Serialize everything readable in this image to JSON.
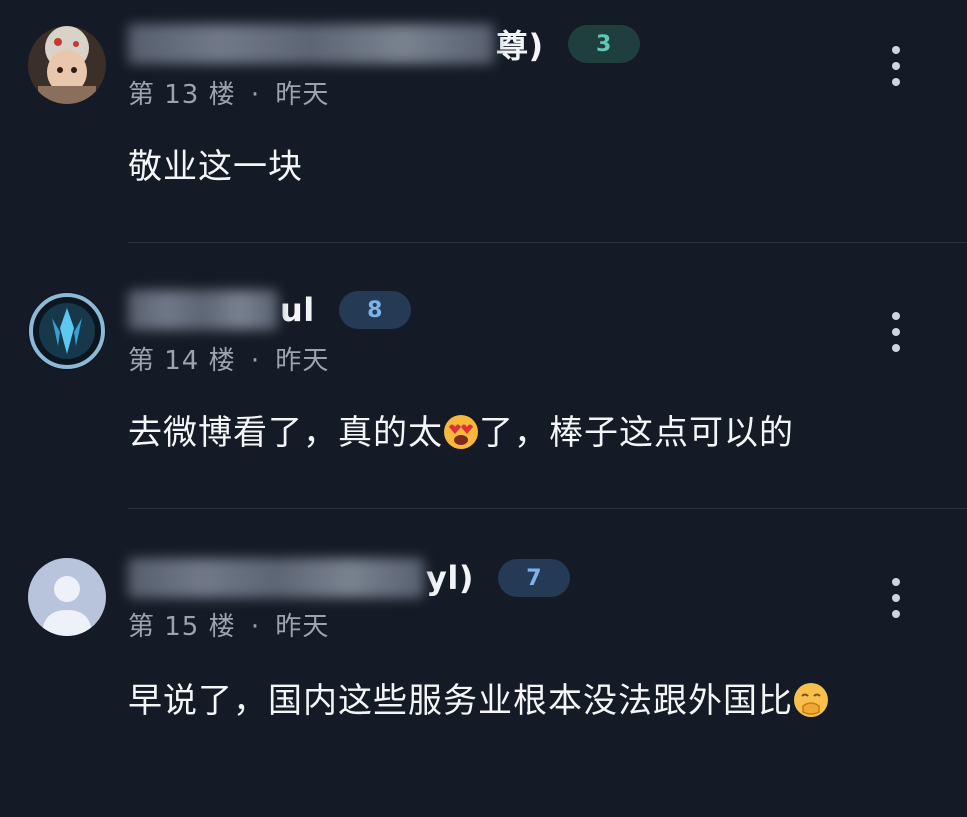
{
  "comments": [
    {
      "name_tail": "尊)",
      "level": "3",
      "level_bg": "#1f3f3f",
      "level_color": "#5fc9b8",
      "floor": "第 13 楼",
      "time": "昨天",
      "text": "敬业这一块"
    },
    {
      "name_tail": "ul",
      "level": "8",
      "level_bg": "#243a55",
      "level_color": "#7fb3e8",
      "floor": "第 14 楼",
      "time": "昨天",
      "text_before": "去微博看了，真的太",
      "text_after": "了，棒子这点可以的",
      "emoji": "heart-eyes-emoji"
    },
    {
      "name_tail": "yl)",
      "level": "7",
      "level_bg": "#243a55",
      "level_color": "#7fb3e8",
      "floor": "第 15 楼",
      "time": "昨天",
      "text": "早说了，国内这些服务业根本没法跟外国比",
      "emoji": "hand-over-mouth-emoji"
    }
  ],
  "separator": "·"
}
